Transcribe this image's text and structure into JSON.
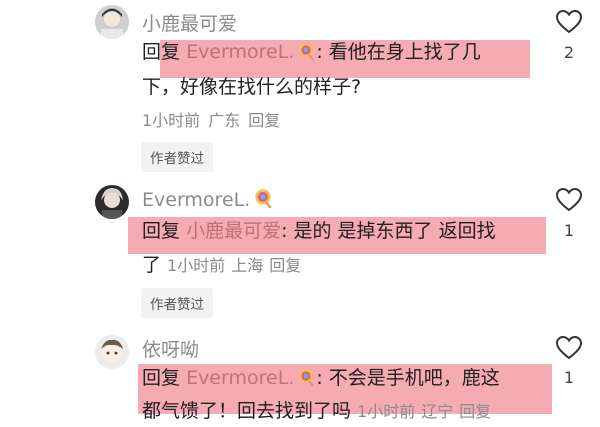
{
  "comments": [
    {
      "username": "小鹿最可爱",
      "has_lollipop": false,
      "reply_prefix": "回复",
      "mention": "EvermoreL.",
      "mention_lollipop": true,
      "text_line1": ": 看他在身上找了几",
      "text_line2": "下，好像在找什么的样子?",
      "time": "1小时前",
      "location": "广东",
      "reply_label": "回复",
      "author_liked": "作者赞过",
      "like_count": "2"
    },
    {
      "username": "EvermoreL.",
      "has_lollipop": true,
      "reply_prefix": "回复",
      "mention": "小鹿最可爱",
      "text_line1": ": 是的 是掉东西了 返回找",
      "text_line2": "了",
      "time": "1小时前",
      "location": "上海",
      "reply_label": "回复",
      "author_liked": "作者赞过",
      "like_count": "1"
    },
    {
      "username": "依呀呦",
      "has_lollipop": false,
      "reply_prefix": "回复",
      "mention": "EvermoreL.",
      "mention_lollipop": true,
      "text_line1": ": 不会是手机吧，鹿这",
      "text_line2": "都气馈了！回去找到了吗",
      "time": "1小时前",
      "location": "辽宁",
      "reply_label": "回复",
      "like_count": "1"
    }
  ],
  "colors": {
    "highlight": "#f07882",
    "mention": "#c0707a",
    "meta": "#8a8a8a"
  }
}
